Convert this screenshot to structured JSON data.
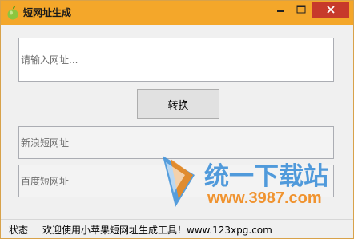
{
  "window": {
    "title": "短网址生成"
  },
  "form": {
    "url_placeholder": "请输入网址...",
    "convert_label": "转换",
    "sina_placeholder": "新浪短网址",
    "baidu_placeholder": "百度短网址"
  },
  "statusbar": {
    "label": "状态",
    "message": "欢迎使用小苹果短网址生成工具！www.123xpg.com"
  },
  "watermark": {
    "brand": "统一下载站",
    "site": "www.3987.com"
  },
  "colors": {
    "titlebar": "#f4a72a",
    "close_button": "#c7392b",
    "watermark_orange": "#f08a1c",
    "watermark_blue": "#3a8ed8"
  }
}
